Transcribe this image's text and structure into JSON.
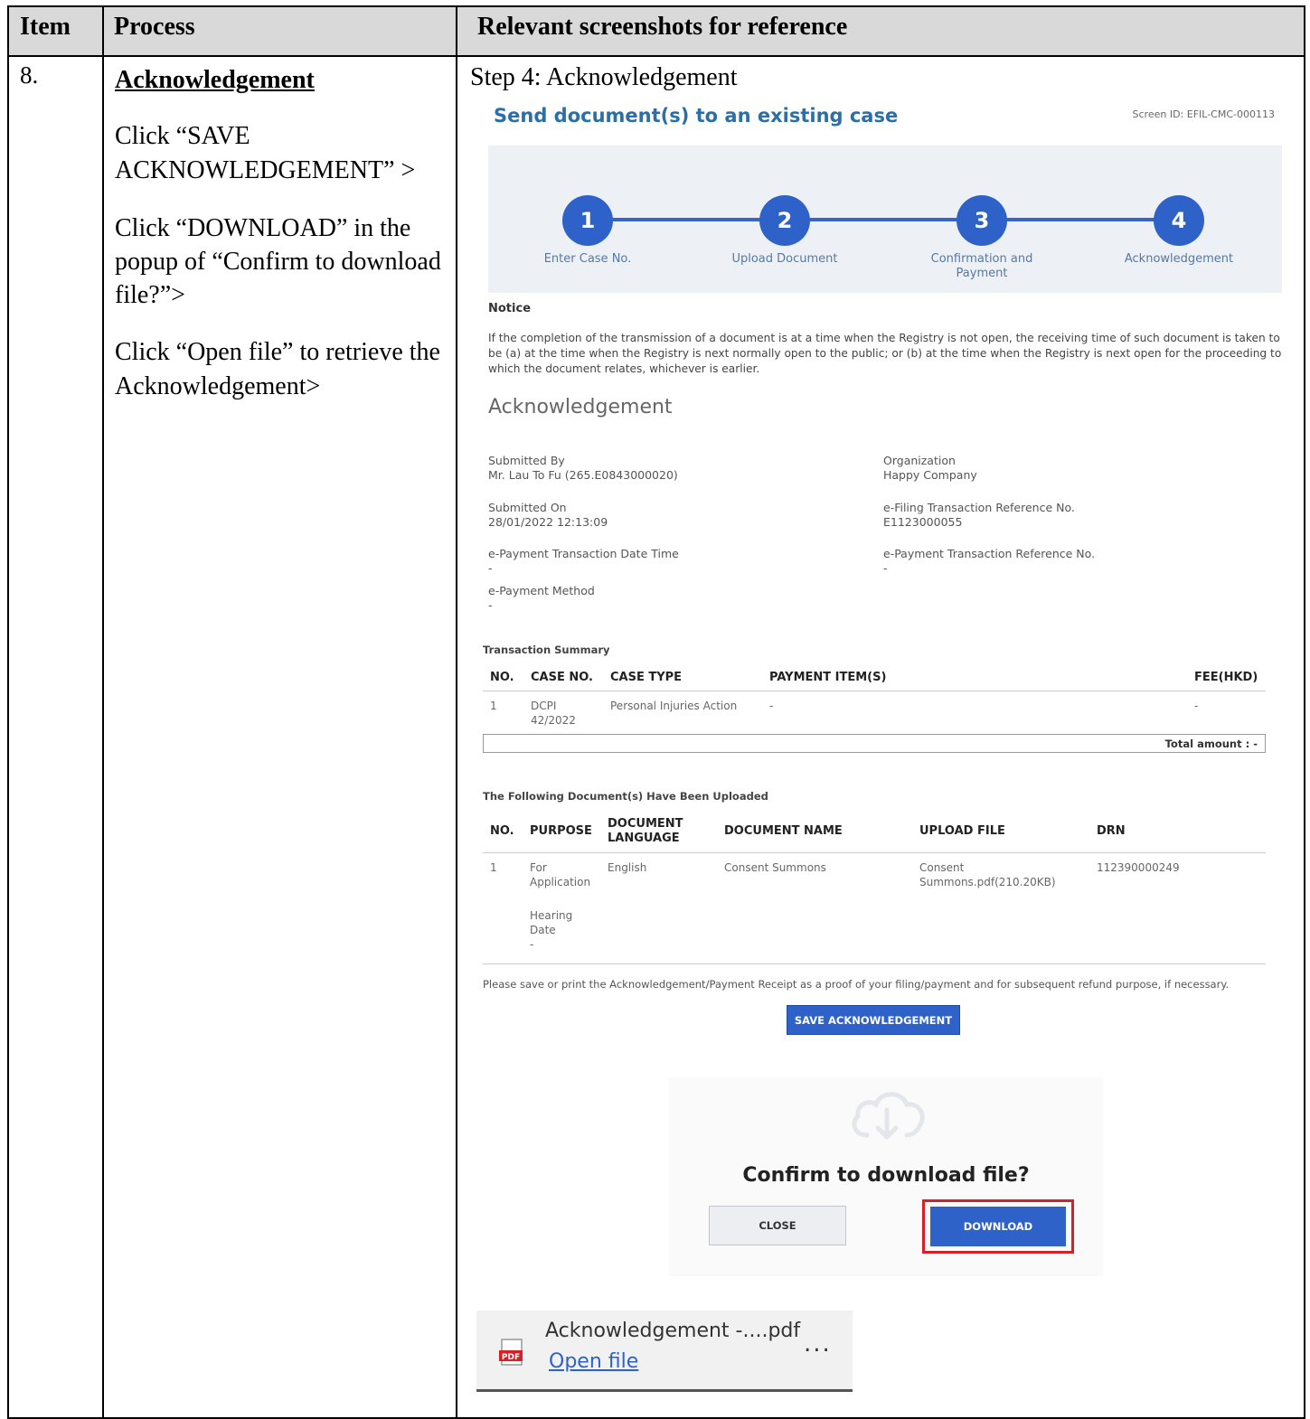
{
  "table": {
    "headers": [
      "Item",
      "Process",
      "Relevant screenshots for reference"
    ],
    "item_no": "8.",
    "process_title": "Acknowledgement",
    "process_steps": [
      "Click “SAVE ACKNOWLEDGEMENT” >",
      "Click “DOWNLOAD” in the popup of “Confirm to download file?”>",
      "Click “Open file” to retrieve the Acknowledgement>"
    ],
    "step_caption": "Step 4: Acknowledgement"
  },
  "screen": {
    "title": "Send document(s) to an existing case",
    "screen_id": "Screen ID: EFIL-CMC-000113",
    "steps": [
      {
        "num": "1",
        "label": "Enter Case No."
      },
      {
        "num": "2",
        "label": "Upload Document"
      },
      {
        "num": "3",
        "label": "Confirmation and Payment"
      },
      {
        "num": "4",
        "label": "Acknowledgement"
      }
    ],
    "notice_heading": "Notice",
    "notice_text": "If the completion of the transmission of a document is at a time when the Registry is not open, the receiving time of such document is taken to be (a) at the time when the Registry is next normally open to the public; or (b) at the time when the Registry is next open for the proceeding to which the document relates, whichever is earlier.",
    "ack_heading": "Acknowledgement",
    "fields": {
      "submitted_by_label": "Submitted By",
      "submitted_by": "Mr. Lau To Fu (265.E0843000020)",
      "organization_label": "Organization",
      "organization": "Happy Company",
      "submitted_on_label": "Submitted On",
      "submitted_on": "28/01/2022 12:13:09",
      "efiling_ref_label": "e-Filing Transaction Reference No.",
      "efiling_ref": "E1123000055",
      "epay_datetime_label": "e-Payment Transaction Date Time",
      "epay_datetime": "-",
      "epay_ref_label": "e-Payment Transaction Reference No.",
      "epay_ref": "-",
      "epay_method_label": "e-Payment Method",
      "epay_method": "-"
    },
    "txn_summary": {
      "heading": "Transaction Summary",
      "columns": [
        "NO.",
        "CASE NO.",
        "CASE TYPE",
        "PAYMENT ITEM(S)",
        "FEE(HKD)"
      ],
      "row": {
        "no": "1",
        "case_no": "DCPI 42/2022",
        "case_type": "Personal Injuries Action",
        "payment_items": "-",
        "fee": "-"
      },
      "total": "Total amount :  -"
    },
    "uploaded": {
      "heading": "The Following Document(s) Have Been Uploaded",
      "columns": [
        "NO.",
        "PURPOSE",
        "DOCUMENT LANGUAGE",
        "DOCUMENT NAME",
        "UPLOAD FILE",
        "DRN"
      ],
      "row": {
        "no": "1",
        "purpose": "For Application",
        "hearing_label": "Hearing Date",
        "hearing_value": "-",
        "language": "English",
        "doc_name": "Consent Summons",
        "upload_file": "Consent Summons.pdf(210.20KB)",
        "drn": "112390000249"
      }
    },
    "save_note": "Please save or print the Acknowledgement/Payment Receipt as a proof of your filing/payment and for subsequent refund purpose, if necessary.",
    "save_button": "SAVE ACKNOWLEDGEMENT"
  },
  "popup": {
    "question": "Confirm to download file?",
    "close_label": "CLOSE",
    "download_label": "DOWNLOAD"
  },
  "download_bar": {
    "file_name": "Acknowledgement -....pdf",
    "open_label": "Open file",
    "more_label": "..."
  },
  "colors": {
    "header_bg": "#d9d9d9",
    "accent_blue": "#2f62c9",
    "highlight_red": "#d61f26"
  }
}
